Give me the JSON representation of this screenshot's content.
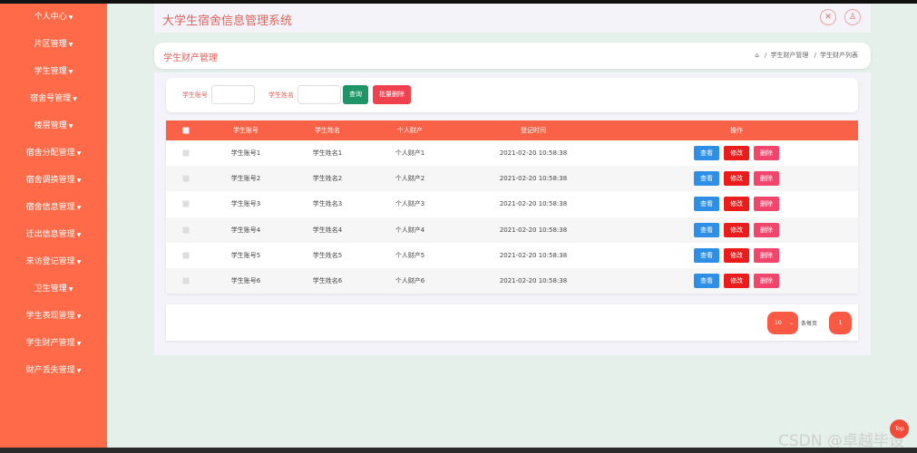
{
  "app": {
    "title": "大学生宿舍信息管理系统",
    "accent": "#ff6a48"
  },
  "sidebar": {
    "items": [
      {
        "label": "个人中心"
      },
      {
        "label": "片区管理"
      },
      {
        "label": "学生管理"
      },
      {
        "label": "宿舍号管理"
      },
      {
        "label": "楼层管理"
      },
      {
        "label": "宿舍分配管理"
      },
      {
        "label": "宿舍调换管理"
      },
      {
        "label": "宿舍信息管理"
      },
      {
        "label": "迁出信息管理"
      },
      {
        "label": "来访登记管理"
      },
      {
        "label": "卫生管理"
      },
      {
        "label": "学生表现管理"
      },
      {
        "label": "学生财产管理"
      },
      {
        "label": "财产丢失管理"
      }
    ]
  },
  "header": {
    "fullscreen_icon": "fullscreen-icon",
    "user_icon": "user-icon"
  },
  "page": {
    "title": "学生财产管理",
    "breadcrumb": [
      "学生财产管理",
      "学生财产列表"
    ]
  },
  "search": {
    "label_account": "学生账号",
    "value_account": "",
    "label_name": "学生姓名",
    "value_name": "",
    "query_label": "查询",
    "batch_delete_label": "批量删除"
  },
  "table": {
    "headers": [
      "学生账号",
      "学生姓名",
      "个人财产",
      "登记时间",
      "操作"
    ],
    "rows": [
      {
        "account": "学生账号1",
        "name": "学生姓名1",
        "property": "个人财产1",
        "time": "2021-02-20 10:58:38"
      },
      {
        "account": "学生账号2",
        "name": "学生姓名2",
        "property": "个人财产2",
        "time": "2021-02-20 10:58:38"
      },
      {
        "account": "学生账号3",
        "name": "学生姓名3",
        "property": "个人财产3",
        "time": "2021-02-20 10:58:38"
      },
      {
        "account": "学生账号4",
        "name": "学生姓名4",
        "property": "个人财产4",
        "time": "2021-02-20 10:58:38"
      },
      {
        "account": "学生账号5",
        "name": "学生姓名5",
        "property": "个人财产5",
        "time": "2021-02-20 10:58:38"
      },
      {
        "account": "学生账号6",
        "name": "学生姓名6",
        "property": "个人财产6",
        "time": "2021-02-20 10:58:38"
      }
    ],
    "actions": {
      "view": "查看",
      "edit": "修改",
      "delete": "删除"
    }
  },
  "pagination": {
    "page_size": "10",
    "page_size_suffix": "条每页",
    "current_page": "1"
  },
  "back_to_top": "Top",
  "watermark": "CSDN @卓越毕设"
}
